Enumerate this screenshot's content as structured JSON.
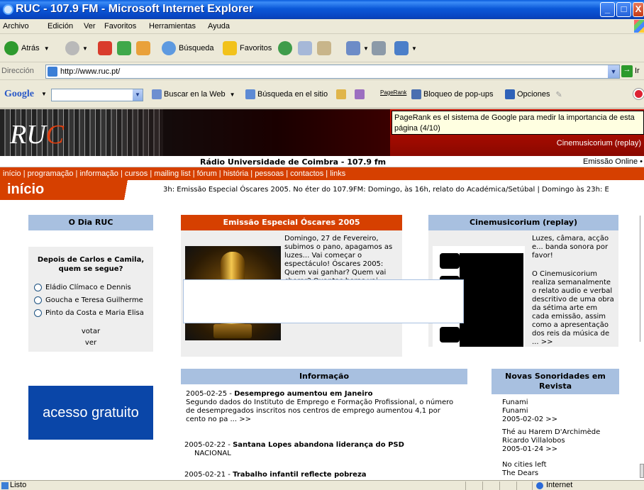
{
  "window": {
    "title": "RUC - 107.9 FM - Microsoft Internet Explorer",
    "min": "_",
    "max": "□",
    "close": "X"
  },
  "menu": [
    "Archivo",
    "Edición",
    "Ver",
    "Favoritos",
    "Herramientas",
    "Ayuda"
  ],
  "toolbar": {
    "back": "Atrás",
    "search": "Búsqueda",
    "favorites": "Favoritos"
  },
  "address": {
    "label": "Dirección",
    "url": "http://www.ruc.pt/",
    "go": "Ir"
  },
  "google": {
    "logo": "Google",
    "search_web": "Buscar en la Web",
    "search_site": "Búsqueda en el sitio",
    "pagerank": "PageRank",
    "popups": "Bloqueo de pop-ups",
    "options": "Opciones"
  },
  "tooltip": "PageRank es el sistema de Google para medir la importancia de esta página (4/10)",
  "banner": {
    "logo_r": "R",
    "logo_u": "U",
    "logo_c": "C",
    "cine": "Cinemusicorium (replay)"
  },
  "station": {
    "name": "Rádio Universidade de Coimbra - 107.9 fm",
    "online": "Emissão Online •"
  },
  "nav": [
    "início",
    "programação",
    "informação",
    "cursos",
    "mailing list",
    "fórum",
    "história",
    "pessoas",
    "contactos",
    "links"
  ],
  "section_title": "início",
  "ticker": "3h: Emissão Especial Óscares 2005.   No éter do 107.9FM: Domingo, às 16h, relato do Académica/Setúbal | Domingo às 23h: E",
  "dia_ruc": {
    "title": "O Dia RUC",
    "question": "Depois de Carlos e Camila, quem se segue?",
    "options": [
      "Eládio Clímaco e Dennis",
      "Goucha e Teresa Guilherme",
      "Pinto da Costa e Maria Elisa"
    ],
    "vote": "votar",
    "view": "ver"
  },
  "acesso": "acesso gratuito",
  "oscares": {
    "title": "Emissão Especial Óscares 2005",
    "text": "Domingo, 27 de Fevereiro, subimos o pano, apagamos as luzes... Vai começar o espectáculo! Óscares 2005: Quem vai ganhar? Quem vai chorar? Quantas horas vai durar? Os vestidos, as jóias, os sapatos, aqueles de quem a Academia se esqueceu - tudo com imparci ... >>"
  },
  "cine": {
    "title": "Cinemusicorium (replay)",
    "p1": "Luzes, câmara, acção e... banda sonora por favor!",
    "p2": "O Cinemusicorium realiza semanalmente o relato audio e verbal descritivo de uma obra da sétima arte em cada emissão, assim como a apresentação dos reis da música de ... >>"
  },
  "informacao": {
    "title": "Informação",
    "items": [
      {
        "date": "2005-02-25 - ",
        "headline": "Desemprego aumentou em Janeiro",
        "body": "Segundo dados do Instituto de Emprego e Formação Profissional, o número de desempregados inscritos nos centros de emprego aumentou 4,1 por cento no pa ... >>"
      },
      {
        "date": "2005-02-22 - ",
        "headline": "Santana Lopes abandona liderança do PSD",
        "body": "NACIONAL"
      },
      {
        "date": "2005-02-21 - ",
        "headline": "Trabalho infantil reflecte pobreza",
        "body": ""
      }
    ]
  },
  "novas": {
    "title": "Novas Sonoridades em Revista",
    "items": [
      {
        "l1": "Funami",
        "l2": "Funami",
        "l3": "2005-02-02 >>"
      },
      {
        "l1": "Thé au Harem D'Archimède",
        "l2": "Ricardo Villalobos",
        "l3": "2005-01-24 >>"
      },
      {
        "l1": "No cities left",
        "l2": "The Dears",
        "l3": ""
      }
    ]
  },
  "status": {
    "text": "Listo",
    "zone": "Internet"
  }
}
